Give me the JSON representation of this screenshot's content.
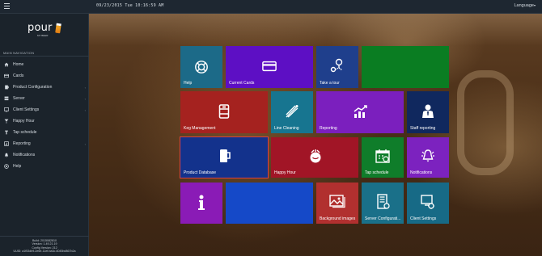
{
  "topbar": {
    "datetime": "09/23/2015 Tue    10:16:59 AM",
    "language": "Language"
  },
  "sidebar": {
    "logo_text": "pour",
    "logo_sub": "MY BEER",
    "section_header": "MAIN NAVIGATION",
    "items": [
      {
        "label": "Home",
        "icon": "home-icon"
      },
      {
        "label": "Cards",
        "icon": "card-icon"
      },
      {
        "label": "Product Configuration",
        "icon": "product-config-icon"
      },
      {
        "label": "Server",
        "icon": "server-icon"
      },
      {
        "label": "Client Settings",
        "icon": "monitor-icon"
      },
      {
        "label": "Happy Hour",
        "icon": "happy-hour-icon"
      },
      {
        "label": "Tap schedule",
        "icon": "tap-schedule-icon"
      },
      {
        "label": "Reporting",
        "icon": "reporting-icon"
      },
      {
        "label": "Notifications",
        "icon": "bell-icon"
      },
      {
        "label": "Help",
        "icon": "help-icon"
      }
    ],
    "build": {
      "line1": "Build: 2015082810",
      "line2": "Version: 1.49.21.19",
      "line3": "Config Version: 212",
      "line4": "UUID: a1f53db9-2e6e-11ef-ba3c-6045bd867b2a"
    }
  },
  "tiles": [
    {
      "id": "help",
      "label": "Help",
      "color": "#1c6a88",
      "icon": "lifebuoy-icon"
    },
    {
      "id": "current-cards",
      "label": "Current Cards",
      "color": "#5d0fc4",
      "icon": "card-icon"
    },
    {
      "id": "take-tour",
      "label": "Take a tour",
      "color": "#1f3f8c",
      "icon": "tour-icon"
    },
    {
      "id": "green-blank",
      "label": "",
      "color": "#0a7d22",
      "icon": ""
    },
    {
      "id": "keg-management",
      "label": "Keg Management",
      "color": "#a5221f",
      "icon": "keg-icon"
    },
    {
      "id": "line-cleaning",
      "label": "Line Cleaning",
      "color": "#177590",
      "icon": "line-cleaning-icon"
    },
    {
      "id": "reporting",
      "label": "Reporting",
      "color": "#7b1fbe",
      "icon": "chart-icon"
    },
    {
      "id": "staff-reporting",
      "label": "Staff reporting",
      "color": "#10285e",
      "icon": "staff-icon"
    },
    {
      "id": "product-database",
      "label": "Product Database",
      "color": "#13328c",
      "icon": "beer-mug-icon"
    },
    {
      "id": "happy-hour",
      "label": "Happy Hour",
      "color": "#a11526",
      "icon": "happy-hour-icon"
    },
    {
      "id": "tap-schedule",
      "label": "Tap schedule",
      "color": "#0f7d2a",
      "icon": "calendar-icon"
    },
    {
      "id": "notifications",
      "label": "Notifications",
      "color": "#7c22bf",
      "icon": "bell-icon"
    },
    {
      "id": "info",
      "label": "",
      "color": "#8a1bb6",
      "icon": "info-icon"
    },
    {
      "id": "blue-blank",
      "label": "",
      "color": "#1549c8",
      "icon": ""
    },
    {
      "id": "background-images",
      "label": "Background images",
      "color": "#b1302f",
      "icon": "image-icon"
    },
    {
      "id": "server-configuration",
      "label": "Server Configurati...",
      "color": "#1a7089",
      "icon": "server-config-icon"
    },
    {
      "id": "client-settings",
      "label": "Client Settings",
      "color": "#176a86",
      "icon": "client-settings-icon"
    }
  ]
}
